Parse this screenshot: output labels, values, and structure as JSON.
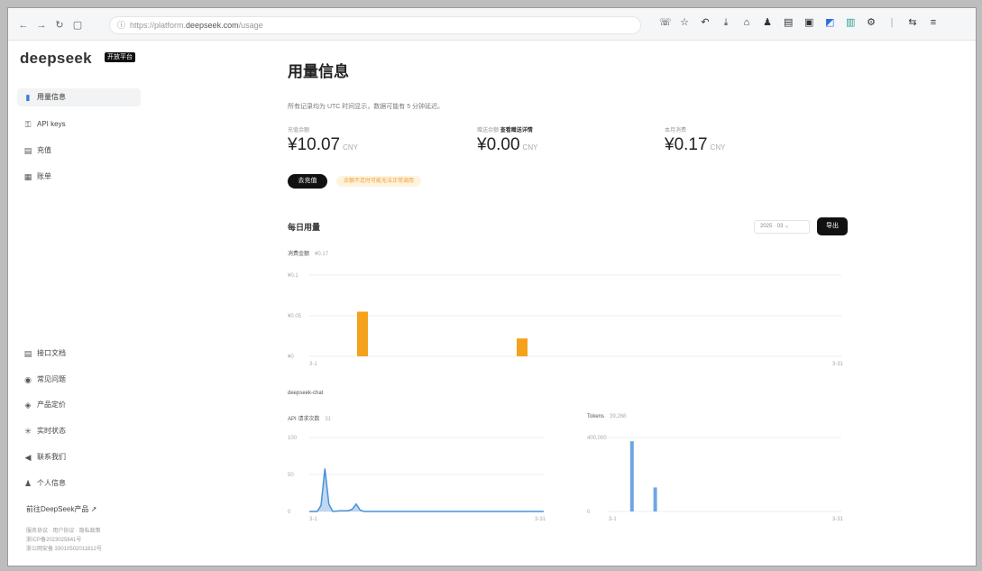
{
  "browser": {
    "url_prefix": "https://platform.",
    "url_host": "deepseek.com",
    "url_path": "/usage"
  },
  "sidebar": {
    "logo": "deepseek",
    "badge": "开放平台",
    "top_items": [
      {
        "label": "用量信息",
        "icon": "bar-chart-icon",
        "active": true
      },
      {
        "label": "API keys",
        "icon": "key-icon",
        "active": false
      },
      {
        "label": "充值",
        "icon": "wallet-icon",
        "active": false
      },
      {
        "label": "账单",
        "icon": "bill-icon",
        "active": false
      }
    ],
    "bottom_items": [
      {
        "label": "接口文档",
        "icon": "doc-icon"
      },
      {
        "label": "常见问题",
        "icon": "help-icon"
      },
      {
        "label": "产品定价",
        "icon": "price-tag-icon"
      },
      {
        "label": "实时状态",
        "icon": "status-icon"
      },
      {
        "label": "联系我们",
        "icon": "megaphone-icon"
      },
      {
        "label": "个人信息",
        "icon": "user-icon"
      }
    ],
    "cta": "前往DeepSeek产品 ↗",
    "footnote": [
      "服务协议 · 用户协议 · 隐私政策",
      "浙ICP备2023025841号",
      "浙公网安备 33010502011812号"
    ]
  },
  "main": {
    "title": "用量信息",
    "note": "所有记录均为 UTC 时间显示，数据可能有 5 分钟延迟。",
    "stats": [
      {
        "label": "充值余额",
        "label_bold": "",
        "value": "¥10.07",
        "unit": "CNY"
      },
      {
        "label": "赠送余额",
        "label_bold": "查看赠送详情",
        "value": "¥0.00",
        "unit": "CNY"
      },
      {
        "label": "本月消费",
        "label_bold": "",
        "value": "¥0.17",
        "unit": "CNY"
      }
    ],
    "topup_button": "去充值",
    "topup_tip": "余额不足时可能无法正常调用",
    "section_title": "每日用量",
    "month_select": "2025 · 03",
    "export_button": "导出",
    "cost_chart_title": "消费金额",
    "cost_chart_sub": "¥0.17",
    "model_title": "deepseek-chat",
    "requests_title": "API 请求次数",
    "requests_sub": "31",
    "tokens_title": "Tokens",
    "tokens_sub": "39,268"
  },
  "chart_data": [
    {
      "type": "bar",
      "title": "消费金额",
      "ytick_labels": [
        "¥0.1",
        "¥0.05",
        "¥0"
      ],
      "ylim": [
        0,
        0.1
      ],
      "x_range": [
        "3-1",
        "3-31"
      ],
      "days": [
        4,
        13
      ],
      "values": [
        0.055,
        0.022
      ],
      "color": "#f4a21b"
    },
    {
      "type": "area",
      "title": "API 请求次数",
      "ytick_labels": [
        "100",
        "50",
        "0"
      ],
      "ylim": [
        0,
        100
      ],
      "x_range": [
        "3-1",
        "3-31"
      ],
      "x": [
        1,
        2,
        2.5,
        3,
        3.5,
        4,
        5,
        6,
        6.5,
        7,
        7.5,
        8,
        9,
        31
      ],
      "values": [
        0,
        0,
        8,
        58,
        10,
        0,
        1,
        1,
        3,
        10,
        2,
        0,
        0,
        0
      ],
      "color": "#4a90d9"
    },
    {
      "type": "bar",
      "title": "Tokens",
      "ytick_labels": [
        "400,000",
        "0"
      ],
      "ylim": [
        0,
        400000
      ],
      "x_range": [
        "3-1",
        "3-31"
      ],
      "days": [
        4,
        7
      ],
      "values": [
        380000,
        130000
      ],
      "color": "#4a90d9"
    }
  ],
  "colors": {
    "accent": "#111111",
    "bar_orange": "#f4a21b",
    "area_blue": "#4a90d9"
  }
}
